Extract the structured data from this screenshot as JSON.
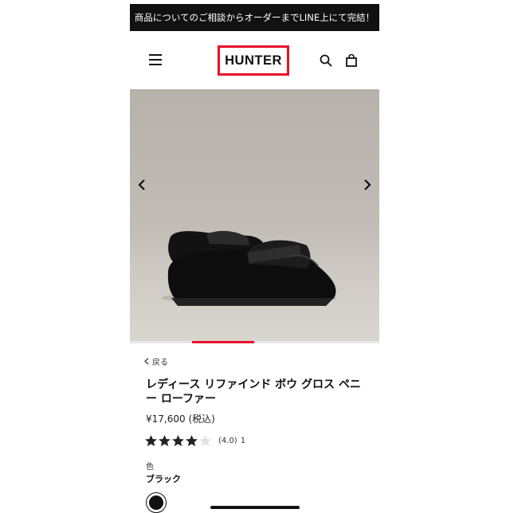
{
  "banner": {
    "text": "商品についてのご相談からオーダーまでLINE上にて完結！"
  },
  "header": {
    "logo_text": "HUNTER",
    "menu_icon": "hamburger-menu-icon",
    "search_icon": "search-icon",
    "bag_icon": "shopping-bag-icon"
  },
  "carousel": {
    "prev_icon": "chevron-left-icon",
    "next_icon": "chevron-right-icon",
    "progress": 0.25
  },
  "product": {
    "back_label": "戻る",
    "title": "レディース リファインド ボウ グロス ペニー ローファー",
    "price": "¥17,600 (税込)",
    "rating_value": 4.0,
    "rating_text": "(4.0)",
    "review_count": "1",
    "color_label": "色",
    "color_value": "ブラック",
    "swatch_color": "#111111"
  },
  "colors": {
    "accent": "#e8102a",
    "banner_bg": "#111111"
  }
}
